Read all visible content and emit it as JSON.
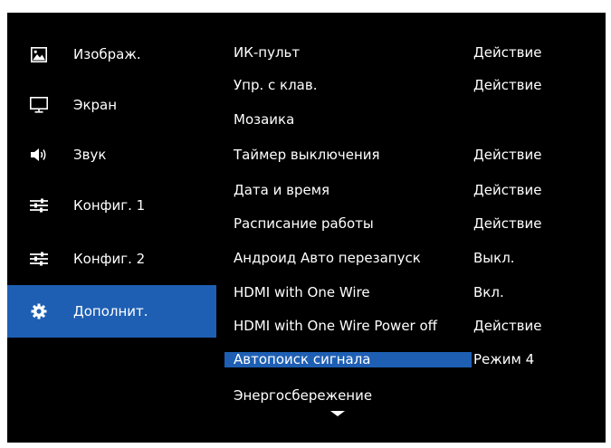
{
  "categories": [
    {
      "label": "Изображ.",
      "icon": "picture-icon",
      "active": false
    },
    {
      "label": "Экран",
      "icon": "monitor-icon",
      "active": false
    },
    {
      "label": "Звук",
      "icon": "speaker-icon",
      "active": false
    },
    {
      "label": "Конфиг. 1",
      "icon": "sliders-icon",
      "active": false
    },
    {
      "label": "Конфиг. 2",
      "icon": "sliders-icon",
      "active": false
    },
    {
      "label": "Дополнит.",
      "icon": "gear-icon",
      "active": true
    }
  ],
  "settings": [
    {
      "label": "ИК-пульт",
      "value": "Действие"
    },
    {
      "label": "Упр. с клав.",
      "value": "Действие"
    },
    {
      "label": "Мозаика",
      "value": ""
    },
    {
      "label": "Таймер выключения",
      "value": "Действие"
    },
    {
      "label": "Дата и время",
      "value": "Действие"
    },
    {
      "label": "Расписание работы",
      "value": "Действие"
    },
    {
      "label": "Андроид Авто перезапуск",
      "value": "Выкл."
    },
    {
      "label": "HDMI with One Wire",
      "value": "Вкл."
    },
    {
      "label": "HDMI with One Wire Power off",
      "value": "Действие"
    },
    {
      "label": "Автопоиск сигнала",
      "value": "Режим 4",
      "selected": true
    },
    {
      "label": "Энергосбережение",
      "value": ""
    }
  ],
  "colors": {
    "background": "#000000",
    "highlight": "#1e5fb4",
    "text": "#ffffff"
  },
  "scroll_indicator": "chevron-down-icon"
}
